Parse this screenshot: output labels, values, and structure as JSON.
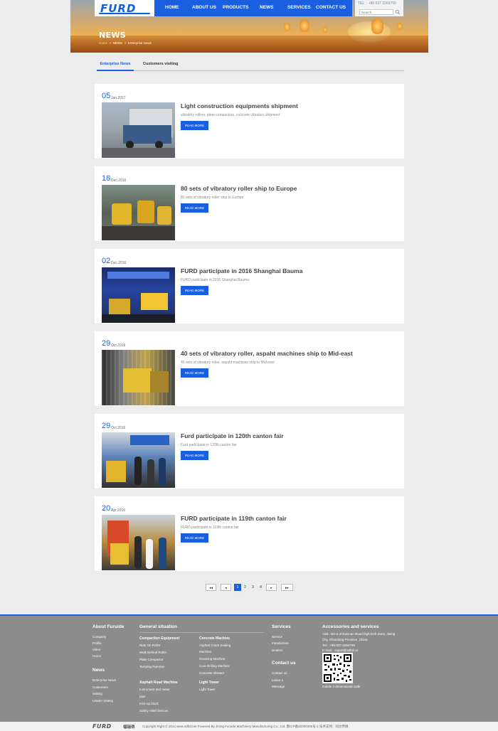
{
  "header": {
    "logo": "FURD",
    "nav": [
      "HOME",
      "ABOUT US",
      "PRODUCTS",
      "NEWS",
      "SERVICES",
      "CONTACT US"
    ],
    "tel": "TEL  : +86 037 2269799",
    "search_placeholder": "Search",
    "page_title": "NEWS",
    "breadcrumb": {
      "home": "Home",
      "sep": ">",
      "news": "NEWS",
      "current": "Enterprise News"
    }
  },
  "tabs": [
    "Enterprise News",
    "Customers visiting"
  ],
  "read_more": "READ MORE",
  "news": [
    {
      "day": "05",
      "month": "Jan.2017",
      "title": "Light construction equipments shipment",
      "summary": "vibratory rollers, plate compactors, concrete vibrators shipment"
    },
    {
      "day": "18",
      "month": "Dec.2016",
      "title": "80 sets of vibratory roller ship to Europe",
      "summary": "80 sets of vibratory roller ship to Europe"
    },
    {
      "day": "02",
      "month": "Dec.2016",
      "title": "FURD participate in 2016 Shanghai Bauma",
      "summary": "FURD participate in 2016 Shanghai Bauma"
    },
    {
      "day": "29",
      "month": "Oct.2016",
      "title": "40 sets of vibratory roller, aspaht machines ship to Mid-east",
      "summary": "40 sets of vibratory roller, aspaht machines ship to Mid-east"
    },
    {
      "day": "29",
      "month": "Oct.2016",
      "title": "Furd participate in 120th canton fair",
      "summary": "Furd participate in 120th canton fair"
    },
    {
      "day": "20",
      "month": "Apr.2016",
      "title": "FURD participate in 119th canton fair",
      "summary": "FURD participate in 119th canton fair"
    }
  ],
  "pagination": {
    "first": "◂◂",
    "prev": "◂",
    "pages": [
      "1",
      "2",
      "3",
      "4"
    ],
    "current": "1",
    "next": "▸",
    "last": "▸▸"
  },
  "footer": {
    "about": {
      "title": "About Furuide",
      "links": [
        "Company",
        "Profile",
        "Video",
        "Honor"
      ]
    },
    "news": {
      "title": "News",
      "links": [
        "Enterprise News",
        "Customers",
        "visiting",
        "Leader visiting"
      ]
    },
    "general": {
      "title": "General situation",
      "compaction": {
        "title": "Compaction Equipment",
        "links": [
          "Ride On Roller",
          "Walk Behind Roller",
          "Plate Compactor",
          "Tamping Rammer"
        ]
      },
      "asphalt": {
        "title": "Asphalt Road Machine",
        "links": [
          "Instrument and meter",
          "pipe",
          "Kick-up block",
          "Safety relief devices"
        ]
      },
      "concrete": {
        "title": "Concrete Machine",
        "links": [
          "Asphalt Crack Sealing",
          "Machine",
          "Grooving Machine",
          "Core Drilling Machine",
          "Concrete Vibrator"
        ]
      },
      "light": {
        "title": "Light Tower",
        "links": [
          "Light Tower"
        ]
      }
    },
    "services": {
      "title": "Services",
      "links": [
        "Service",
        "Introduction",
        "Dealers"
      ]
    },
    "contact": {
      "title": "Contact us",
      "links": [
        "Contact us",
        "Leave a",
        "Message"
      ]
    },
    "accessories": {
      "title": "Accessories and services",
      "address_lines": [
        "Add.: NO.6 of Kaixuan Road,high-tech Zone, Jining",
        "City, Shandong Province, China"
      ],
      "tel": "Tel：+86-037-2269799",
      "email": "E-mail：export@sdfrd.co",
      "qr_caption": "mobile 2-dimensional code"
    },
    "bottom_logo": "FURD",
    "bottom_logo_cn": "福瑞得",
    "copyright": "Copyright Right © 2014 www.sdfrd.net Powered By Jining Furuide Machinery Manufacturing Co., Ltd. 鲁ICP备32000306号-1 技术支持：同达传媒"
  },
  "colors": {
    "accent": "#1a5fe0",
    "footer": "#8c8c8c",
    "background": "#ececec"
  }
}
